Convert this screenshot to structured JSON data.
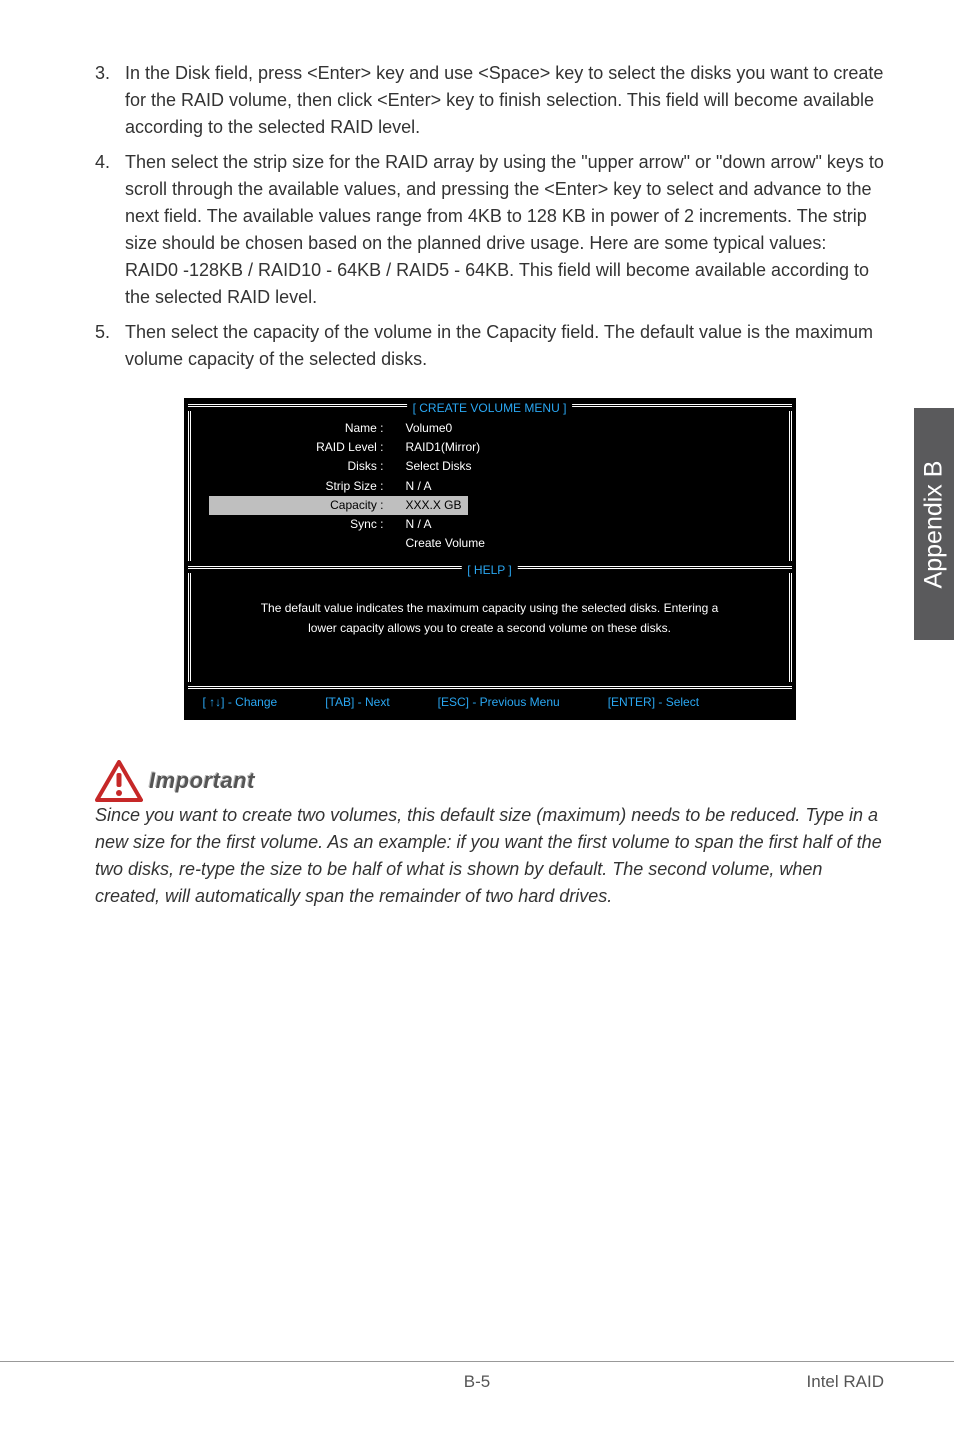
{
  "list": [
    {
      "num": "3.",
      "text": "In the Disk field, press <Enter> key and use <Space> key to select the disks you want to create for the RAID volume, then click <Enter> key to finish selection. This field will become available according to the selected RAID level."
    },
    {
      "num": "4.",
      "text": "Then select the strip size for the RAID array by using the \"upper arrow\" or \"down arrow\" keys to scroll through the available values, and pressing the <Enter> key to select and advance to the next field. The available values range from 4KB to 128 KB in power of 2 increments. The strip size should be chosen based on the planned drive usage. Here are some typical values:\nRAID0 -128KB / RAID10 - 64KB / RAID5 - 64KB. This field will become available according to the selected RAID level."
    },
    {
      "num": "5.",
      "text": "Then select the capacity of the volume in the Capacity field. The default value is the maximum volume capacity of the selected disks."
    }
  ],
  "sideTab": "Appendix B",
  "bios": {
    "panel1Title": "[  CREATE VOLUME MENU  ]",
    "panel2Title": "[   HELP   ]",
    "rows": [
      {
        "label": "Name :",
        "value": "Volume0",
        "selected": false
      },
      {
        "label": "RAID Level :",
        "value": "RAID1(Mirror)",
        "selected": false
      },
      {
        "label": "Disks :",
        "value": "Select  Disks",
        "selected": false
      },
      {
        "label": "Strip Size :",
        "value": "N / A",
        "selected": false
      },
      {
        "label": "Capacity :",
        "value": "XXX.X  GB",
        "selected": true
      },
      {
        "label": "Sync :",
        "value": "N / A",
        "selected": false
      },
      {
        "label": "",
        "value": "Create Volume",
        "selected": false
      }
    ],
    "help": "The default value indicates the maximum capacity using the selected disks. Entering a lower capacity allows you to create a second volume  on  these  disks.",
    "footer": {
      "change": "[ ↑↓] - Change",
      "tab": "[TAB] - Next",
      "esc": "[ESC] - Previous Menu",
      "enter": "[ENTER] - Select"
    }
  },
  "important": {
    "label": "Important",
    "text": "Since you want to create two volumes, this default size (maximum) needs to be reduced. Type in a new size for the first volume. As an example: if you want the first volume to span the first half of the two disks, re-type the size to be half of what is shown by default. The second volume, when created, will automatically span the remainder of two hard drives."
  },
  "footer": {
    "pageNum": "B-5",
    "section": "Intel RAID"
  }
}
